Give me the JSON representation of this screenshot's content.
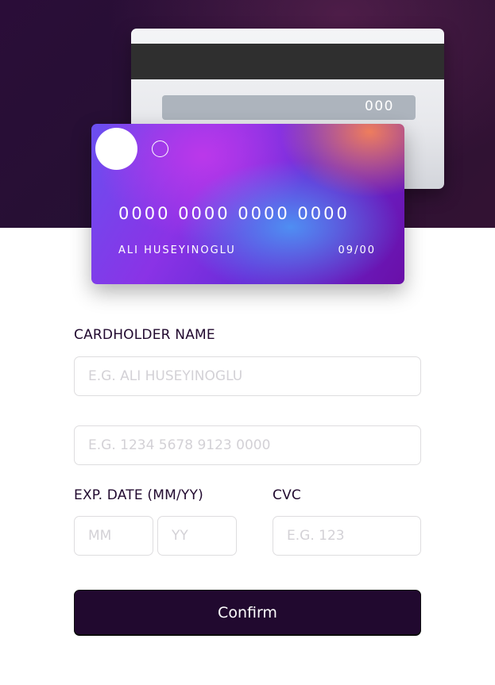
{
  "colors": {
    "hero_background": "#2a0d38",
    "dark_violet": "#21092f",
    "field_border": "#dedddf",
    "placeholder": "#d3d1d6",
    "white": "#ffffff"
  },
  "card_back": {
    "cvc": "000"
  },
  "card_front": {
    "number": "0000 0000 0000 0000",
    "name": "ALI HUSEYINOGLU",
    "expiry": "09/00"
  },
  "form": {
    "cardholder": {
      "label": "CARDHOLDER NAME",
      "placeholder": "E.G. ALI HUSEYINOGLU"
    },
    "card_number": {
      "placeholder": "E.G. 1234 5678 9123 0000"
    },
    "expiry": {
      "label": "EXP. DATE (MM/YY)",
      "month_placeholder": "MM",
      "year_placeholder": "YY"
    },
    "cvc": {
      "label": "CVC",
      "placeholder": "E.G. 123"
    },
    "confirm_label": "Confirm"
  }
}
